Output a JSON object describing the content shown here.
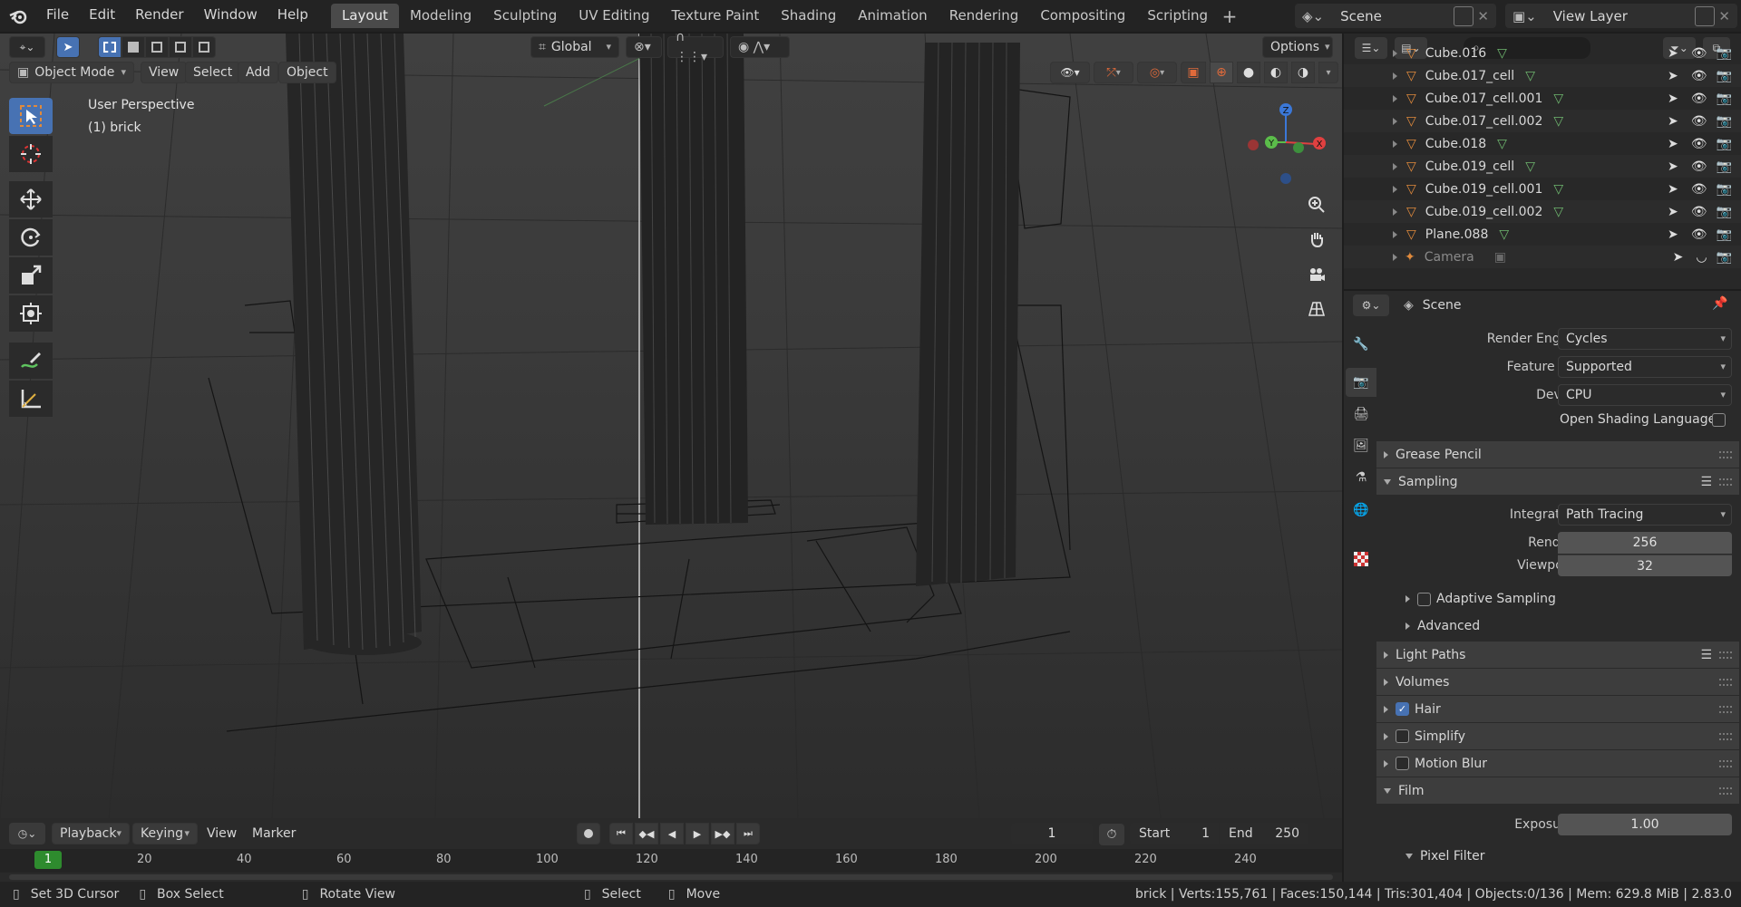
{
  "menubar": {
    "items": [
      "File",
      "Edit",
      "Render",
      "Window",
      "Help"
    ]
  },
  "workspaces": {
    "tabs": [
      "Layout",
      "Modeling",
      "Sculpting",
      "UV Editing",
      "Texture Paint",
      "Shading",
      "Animation",
      "Rendering",
      "Compositing",
      "Scripting"
    ],
    "active": "Layout"
  },
  "scene": {
    "name": "Scene",
    "view_layer": "View Layer"
  },
  "viewport": {
    "transform_orientation": "Global",
    "options_label": "Options",
    "mode": "Object Mode",
    "menus": [
      "View",
      "Select",
      "Add",
      "Object"
    ],
    "overlay_line1": "User Perspective",
    "overlay_line2": "(1) brick",
    "gizmo_axes": {
      "x": "X",
      "y": "Y",
      "z": "Z"
    }
  },
  "outliner": {
    "rows": [
      "Cube.016",
      "Cube.017_cell",
      "Cube.017_cell.001",
      "Cube.017_cell.002",
      "Cube.018",
      "Cube.019_cell",
      "Cube.019_cell.001",
      "Cube.019_cell.002",
      "Plane.088",
      "Camera"
    ]
  },
  "properties": {
    "context": "Scene",
    "render_engine_label": "Render Engine",
    "render_engine": "Cycles",
    "feature_set_label": "Feature Set",
    "feature_set": "Supported",
    "device_label": "Device",
    "device": "CPU",
    "osl_label": "Open Shading Language",
    "grease_pencil": "Grease Pencil",
    "sampling": "Sampling",
    "integrator_label": "Integrator",
    "integrator": "Path Tracing",
    "render_label": "Render",
    "render_value": "256",
    "viewport_label": "Viewport",
    "viewport_value": "32",
    "adaptive_sampling": "Adaptive Sampling",
    "advanced": "Advanced",
    "light_paths": "Light Paths",
    "volumes": "Volumes",
    "hair": "Hair",
    "simplify": "Simplify",
    "motion_blur": "Motion Blur",
    "film": "Film",
    "exposure_label": "Exposure",
    "exposure_value": "1.00",
    "pixel_filter": "Pixel Filter"
  },
  "timeline": {
    "menus": [
      "Playback",
      "Keying",
      "View",
      "Marker"
    ],
    "current_frame": "1",
    "start_label": "Start",
    "start": "1",
    "end_label": "End",
    "end": "250",
    "ruler": [
      "20",
      "40",
      "60",
      "80",
      "100",
      "120",
      "140",
      "160",
      "180",
      "200",
      "220",
      "240"
    ],
    "playhead": "1"
  },
  "statusbar": {
    "hints": [
      "Set 3D Cursor",
      "Box Select",
      "Rotate View",
      "Select",
      "Move"
    ],
    "stats": "brick | Verts:155,761 | Faces:150,144 | Tris:301,404 | Objects:0/136 | Mem: 629.8 MiB | 2.83.0"
  },
  "colors": {
    "accent": "#4772b3",
    "object_orange": "#e08a3c",
    "mesh_green": "#6fb86f",
    "playhead": "#2e8b2e",
    "axis_x": "#e04040",
    "axis_y": "#5bbd4a",
    "axis_z": "#3b78d8"
  }
}
